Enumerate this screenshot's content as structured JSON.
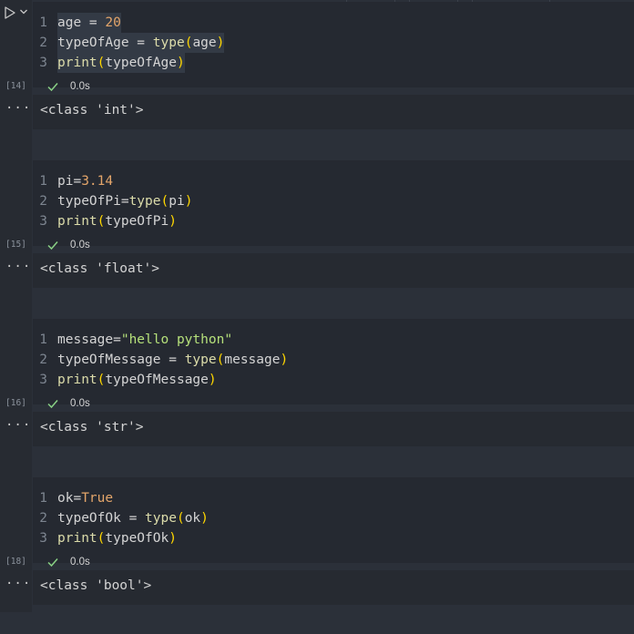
{
  "cells": [
    {
      "exec_count": "[14]",
      "time": "0.0s",
      "output": "<class 'int'>",
      "lines": [
        {
          "no": "1",
          "tokens": [
            [
              "age",
              "var"
            ],
            [
              " = ",
              "op"
            ],
            [
              "20",
              "num"
            ]
          ]
        },
        {
          "no": "2",
          "tokens": [
            [
              "typeOfAge",
              "var"
            ],
            [
              " = ",
              "op"
            ],
            [
              "type",
              "fn"
            ],
            [
              "(",
              "paren"
            ],
            [
              "age",
              "var"
            ],
            [
              ")",
              "paren"
            ]
          ]
        },
        {
          "no": "3",
          "tokens": [
            [
              "print",
              "fn"
            ],
            [
              "(",
              "paren"
            ],
            [
              "typeOfAge",
              "var"
            ],
            [
              ")",
              "paren"
            ]
          ]
        }
      ]
    },
    {
      "exec_count": "[15]",
      "time": "0.0s",
      "output": "<class 'float'>",
      "lines": [
        {
          "no": "1",
          "tokens": [
            [
              "pi",
              "var"
            ],
            [
              "=",
              "op"
            ],
            [
              "3.14",
              "num"
            ]
          ]
        },
        {
          "no": "2",
          "tokens": [
            [
              "typeOfPi",
              "var"
            ],
            [
              "=",
              "op"
            ],
            [
              "type",
              "fn"
            ],
            [
              "(",
              "paren"
            ],
            [
              "pi",
              "var"
            ],
            [
              ")",
              "paren"
            ]
          ]
        },
        {
          "no": "3",
          "tokens": [
            [
              "print",
              "fn"
            ],
            [
              "(",
              "paren"
            ],
            [
              "typeOfPi",
              "var"
            ],
            [
              ")",
              "paren"
            ]
          ]
        }
      ]
    },
    {
      "exec_count": "[16]",
      "time": "0.0s",
      "output": "<class 'str'>",
      "lines": [
        {
          "no": "1",
          "tokens": [
            [
              "message",
              "var"
            ],
            [
              "=",
              "op"
            ],
            [
              "\"hello python\"",
              "str"
            ]
          ]
        },
        {
          "no": "2",
          "tokens": [
            [
              "typeOfMessage",
              "var"
            ],
            [
              " = ",
              "op"
            ],
            [
              "type",
              "fn"
            ],
            [
              "(",
              "paren"
            ],
            [
              "message",
              "var"
            ],
            [
              ")",
              "paren"
            ]
          ]
        },
        {
          "no": "3",
          "tokens": [
            [
              "print",
              "fn"
            ],
            [
              "(",
              "paren"
            ],
            [
              "typeOfMessage",
              "var"
            ],
            [
              ")",
              "paren"
            ]
          ]
        }
      ]
    },
    {
      "exec_count": "[18]",
      "time": "0.0s",
      "output": "<class 'bool'>",
      "lines": [
        {
          "no": "1",
          "tokens": [
            [
              "ok",
              "var"
            ],
            [
              "=",
              "op"
            ],
            [
              "True",
              "bool"
            ]
          ]
        },
        {
          "no": "2",
          "tokens": [
            [
              "typeOfOk",
              "var"
            ],
            [
              " = ",
              "op"
            ],
            [
              "type",
              "fn"
            ],
            [
              "(",
              "paren"
            ],
            [
              "ok",
              "var"
            ],
            [
              ")",
              "paren"
            ]
          ]
        },
        {
          "no": "3",
          "tokens": [
            [
              "print",
              "fn"
            ],
            [
              "(",
              "paren"
            ],
            [
              "typeOfOk",
              "var"
            ],
            [
              ")",
              "paren"
            ]
          ]
        }
      ]
    }
  ],
  "output_ellipsis": "···",
  "icons": {
    "run": "run-cell-icon",
    "run_menu": "chevron-down-icon",
    "success": "checkmark-icon",
    "more": "ellipsis-icon"
  },
  "colors": {
    "success": "#89d185",
    "keyword": "#4ec9b0",
    "function": "#dcdcaa",
    "string": "#b5e07a",
    "number": "#e3a56a",
    "bracket": "#ffd700"
  }
}
